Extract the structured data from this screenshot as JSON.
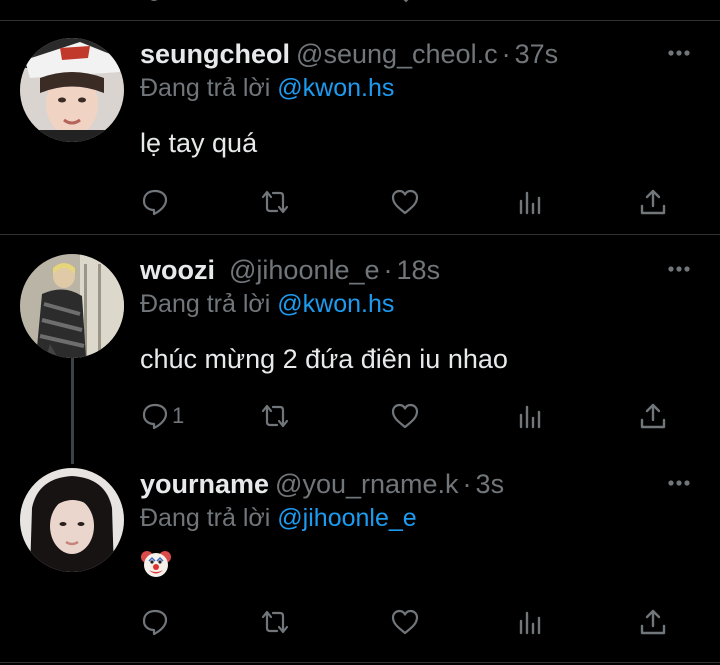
{
  "tweets": [
    {
      "name": "seungcheol",
      "handle": "@seung_cheol.c",
      "time": "37s",
      "replying_prefix": "Đang trả lời",
      "replying_to": "@kwon.hs",
      "text": "lẹ tay quá",
      "reply_count": ""
    },
    {
      "name": "woozi",
      "handle": "@jihoonle_e",
      "time": "18s",
      "replying_prefix": "Đang trả lời",
      "replying_to": "@kwon.hs",
      "text": "chúc mừng 2 đứa điên iu nhao",
      "reply_count": "1"
    },
    {
      "name": "yourname",
      "handle": "@you_rname.k",
      "time": "3s",
      "replying_prefix": "Đang trả lời",
      "replying_to": "@jihoonle_e",
      "text": "",
      "emoji": "clown-face-emoji",
      "reply_count": ""
    }
  ],
  "separator": "·",
  "colors": {
    "background": "#000000",
    "primary_text": "#e7e9ea",
    "secondary_text": "#71767b",
    "mention": "#1d9bf0",
    "divider": "#2f3336"
  },
  "icons": [
    "reply-icon",
    "retweet-icon",
    "like-icon",
    "views-icon",
    "share-icon",
    "more-icon"
  ]
}
